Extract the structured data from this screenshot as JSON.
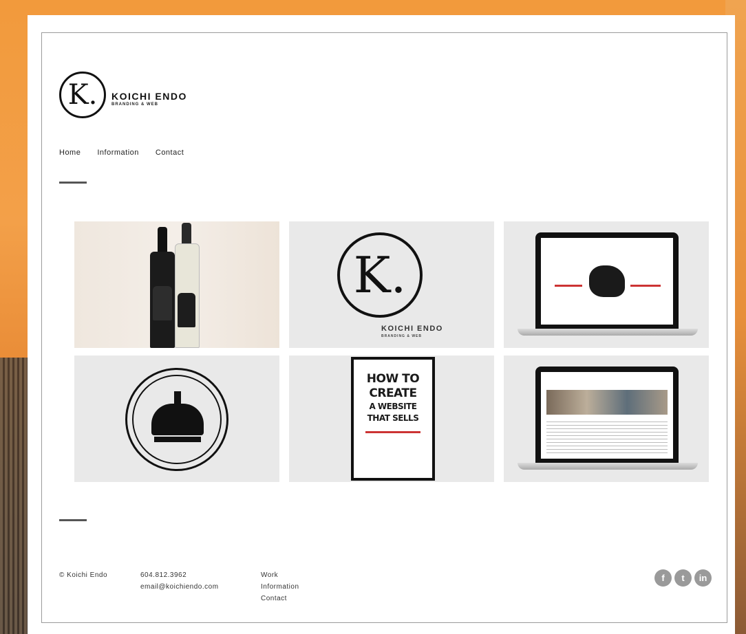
{
  "brand": {
    "mark": "K.",
    "name": "KOICHI ENDO",
    "tagline": "BRANDING & WEB"
  },
  "nav": {
    "items": [
      {
        "label": "Home"
      },
      {
        "label": "Information"
      },
      {
        "label": "Contact"
      }
    ]
  },
  "portfolio": {
    "poster": {
      "line1": "HOW TO",
      "line2": "CREATE",
      "line3": "A WEBSITE",
      "line4": "THAT SELLS"
    }
  },
  "footer": {
    "copyright": "© Koichi Endo",
    "phone": "604.812.3962",
    "email": "email@koichiendo.com",
    "links": [
      {
        "label": "Work"
      },
      {
        "label": "Information"
      },
      {
        "label": "Contact"
      }
    ],
    "social": [
      {
        "icon": "facebook-icon",
        "glyph": "f"
      },
      {
        "icon": "twitter-icon",
        "glyph": "t"
      },
      {
        "icon": "linkedin-icon",
        "glyph": "in"
      }
    ]
  }
}
